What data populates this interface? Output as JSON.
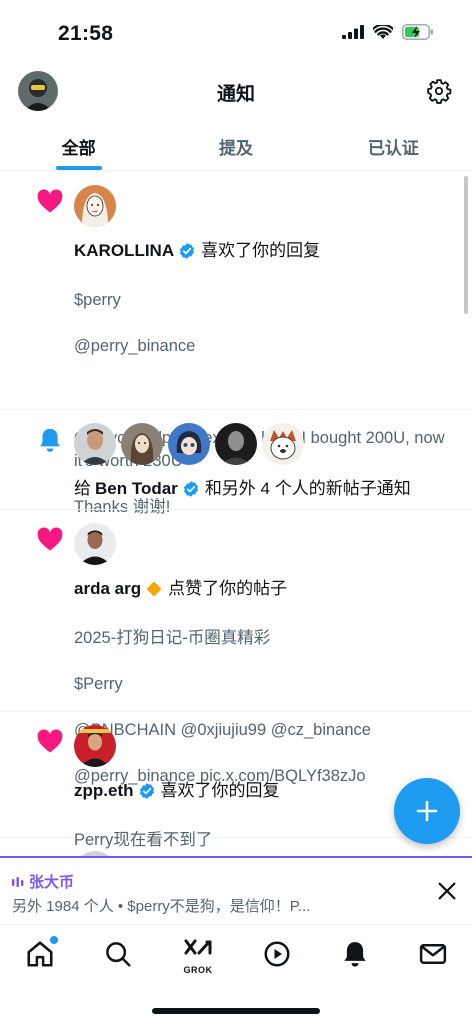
{
  "status_bar": {
    "time": "21:58"
  },
  "header": {
    "title": "通知"
  },
  "tabs": [
    {
      "label": "全部",
      "active": true
    },
    {
      "label": "提及",
      "active": false
    },
    {
      "label": "已认证",
      "active": false
    }
  ],
  "notifications": [
    {
      "kind": "like",
      "user": "KAROLLINA",
      "verified": true,
      "action": "喜欢了你的回复",
      "lines": [
        "$perry",
        "@perry_binance",
        "",
        "Can you help me expose him? I bought 200U, now it's worth 230U",
        "Thanks 谢谢!"
      ]
    },
    {
      "kind": "bell",
      "prefix": "给",
      "user": "Ben Todar",
      "verified": true,
      "action": "和另外 4 个人的新帖子通知"
    },
    {
      "kind": "like",
      "user": "arda arg",
      "badge": "diamond",
      "action": "点赞了你的帖子",
      "lines": [
        "2025-打狗日记-币圈真精彩",
        "$Perry",
        "@BNBCHAIN @0xjiujiu99 @cz_binance",
        "@perry_binance pic.x.com/BQLYf38zJo"
      ]
    },
    {
      "kind": "like",
      "user": "zpp.eth",
      "verified": true,
      "action": "喜欢了你的回复",
      "lines": [
        "Perry现在看不到了"
      ]
    }
  ],
  "space": {
    "title": "张大币",
    "subtitle": "另外 1984 个人 • $perry不是狗，是信仰！P..."
  },
  "bottom_nav": {
    "grok_label": "GROK"
  },
  "colors": {
    "accent": "#1d9bf0",
    "like": "#f91880",
    "space": "#7856ff",
    "diamond": "#f7a600"
  }
}
